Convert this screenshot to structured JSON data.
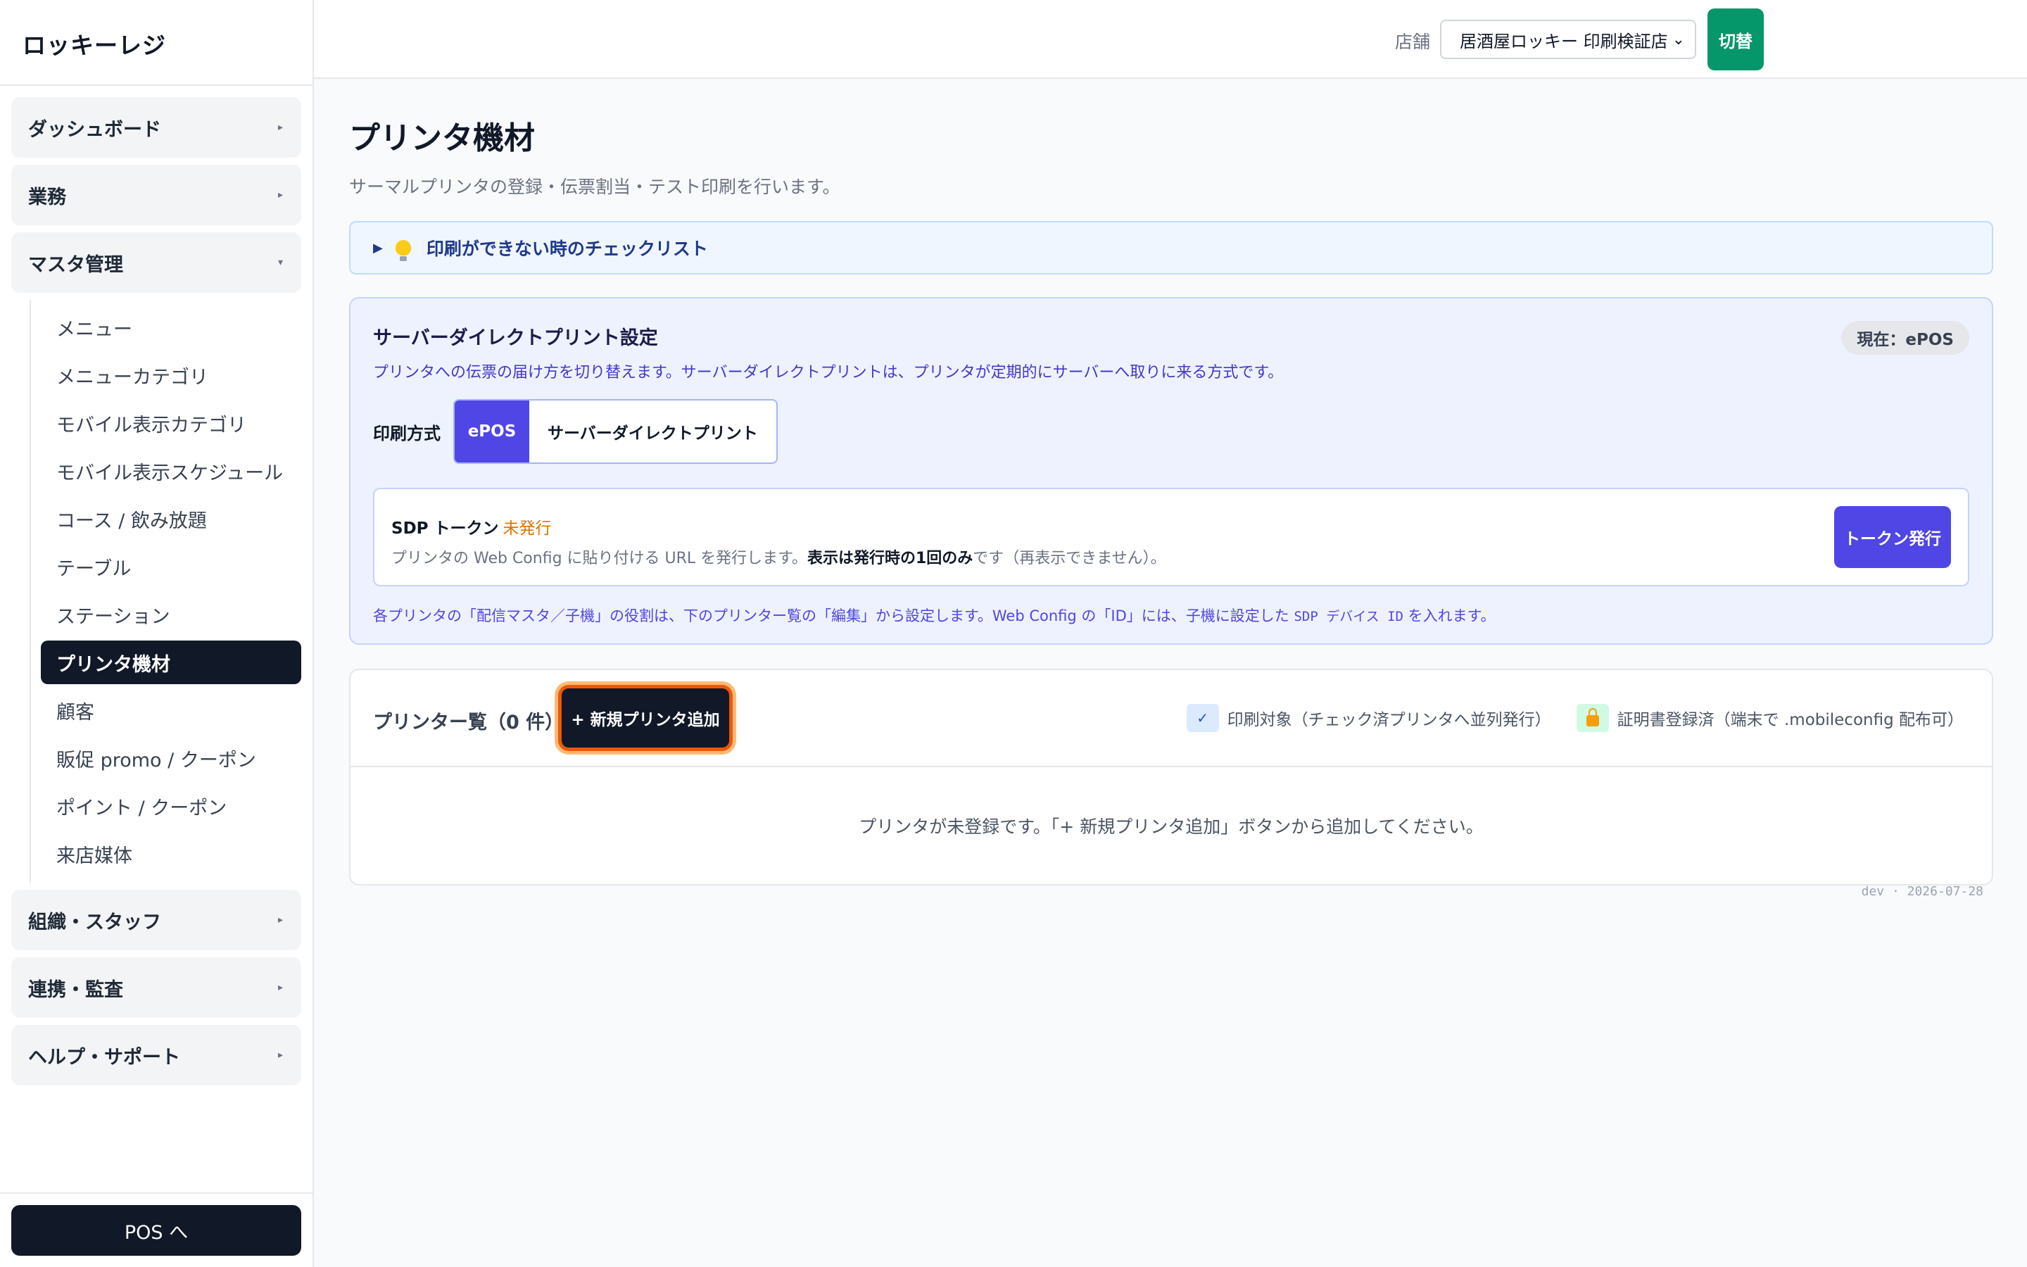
{
  "sidebar": {
    "brand": "ロッキーレジ",
    "groups": [
      {
        "label": "ダッシュボード",
        "caret": "▸"
      },
      {
        "label": "業務",
        "caret": "▸"
      },
      {
        "label": "マスタ管理",
        "caret": "▾"
      }
    ],
    "submenu": [
      "メニュー",
      "メニューカテゴリ",
      "モバイル表示カテゴリ",
      "モバイル表示スケジュール",
      "コース / 飲み放題",
      "テーブル",
      "ステーション",
      "プリンタ機材",
      "顧客",
      "販促 promo / クーポン",
      "ポイント / クーポン",
      "来店媒体"
    ],
    "active_submenu": "プリンタ機材",
    "bottom_groups": [
      {
        "label": "組織・スタッフ",
        "caret": "▸"
      },
      {
        "label": "連携・監査",
        "caret": "▸"
      },
      {
        "label": "ヘルプ・サポート",
        "caret": "▸"
      }
    ],
    "pos_button": "POS へ"
  },
  "header": {
    "store_label": "店舗",
    "store_value": "居酒屋ロッキー 印刷検証店",
    "switch_button": "切替"
  },
  "main": {
    "title": "プリンタ機材",
    "subtitle": "サーマルプリンタの登録・伝票割当・テスト印刷を行います。",
    "checklist": "印刷ができない時のチェックリスト",
    "sdp": {
      "title": "サーバーダイレクトプリント設定",
      "description": "プリンタへの伝票の届け方を切り替えます。サーバーダイレクトプリントは、プリンタが定期的にサーバーへ取りに来る方式です。",
      "badge": "現在：ePOS",
      "mode_label": "印刷方式",
      "mode_options": [
        "ePOS",
        "サーバーダイレクトプリント"
      ],
      "token_label": "SDP トークン",
      "token_status": "未発行",
      "token_desc_1": "プリンタの Web Config に貼り付ける URL を発行します。",
      "token_desc_bold": "表示は発行時の1回のみ",
      "token_desc_2": "です（再表示できません）。",
      "token_button": "トークン発行",
      "note_1": "各プリンタの「配信マスタ／子機」の役割は、下のプリンター覧の「編集」から設定します。Web Config の「ID」には、子機に設定した",
      "note_mono": "SDP デバイス ID",
      "note_2": "を入れます。"
    },
    "printers": {
      "title": "プリンター覧（0 件）",
      "add_button": "+ 新規プリンタ追加",
      "legend_check": "印刷対象（チェック済プリンタへ並列発行）",
      "legend_lock": "証明書登録済（端末で .mobileconfig 配布可）",
      "empty": "プリンタが未登録です。「+ 新規プリンタ追加」ボタンから追加してください。"
    },
    "stamp": "dev · 2026-07-28"
  },
  "colors": {
    "accent": "#4f46e5",
    "dark": "#111827",
    "success": "#059669",
    "warning": "#d97706"
  }
}
